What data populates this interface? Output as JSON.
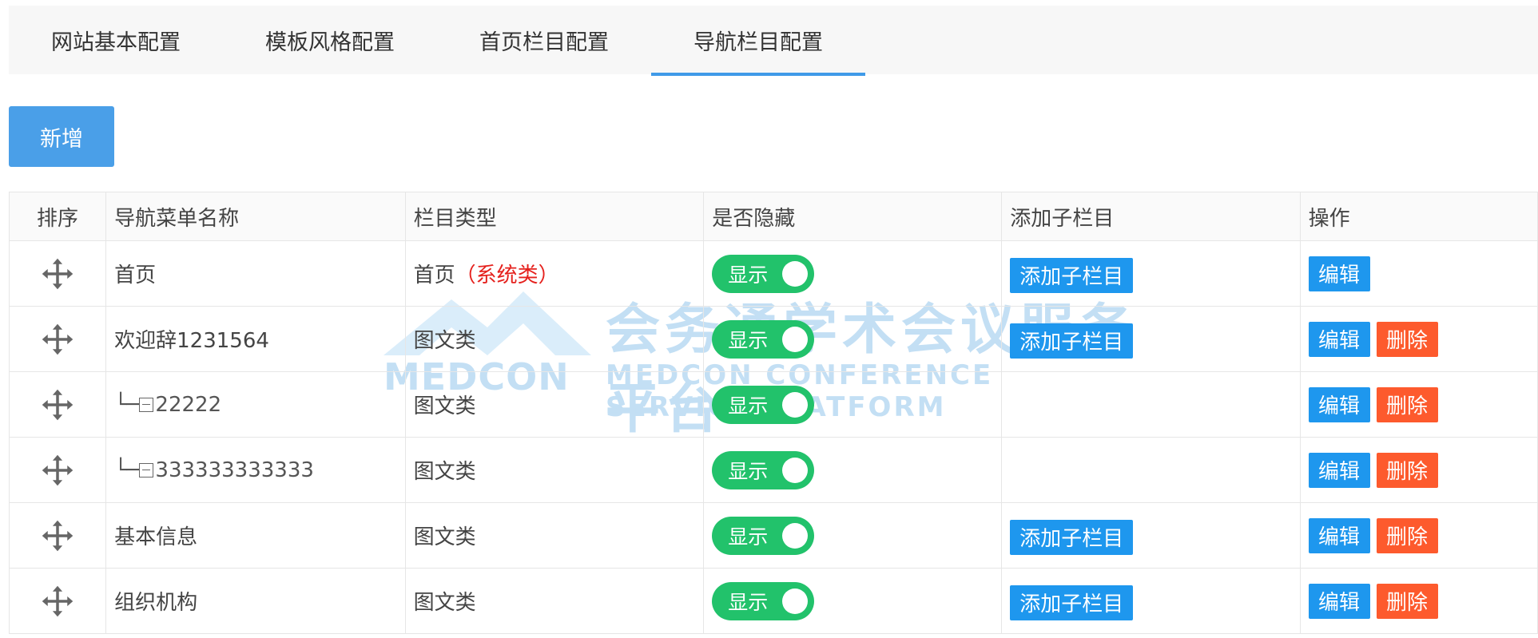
{
  "tabs": [
    "网站基本配置",
    "模板风格配置",
    "首页栏目配置",
    "导航栏目配置"
  ],
  "active_tab": "导航栏目配置",
  "add_button": "新增",
  "columns": [
    "排序",
    "导航菜单名称",
    "栏目类型",
    "是否隐藏",
    "添加子栏目",
    "操作"
  ],
  "rows": [
    {
      "name": "首页",
      "type": "首页",
      "type_note": "（系统类）",
      "toggle": "显示",
      "add_sub": "添加子栏目",
      "edit": "编辑",
      "delete": ""
    },
    {
      "name": "欢迎辞1231564",
      "type": "图文类",
      "type_note": "",
      "toggle": "显示",
      "add_sub": "添加子栏目",
      "edit": "编辑",
      "delete": "删除"
    },
    {
      "name": "22222",
      "type": "图文类",
      "type_note": "",
      "toggle": "显示",
      "add_sub": "",
      "edit": "编辑",
      "delete": "删除",
      "tree_prefix": "└─"
    },
    {
      "name": "333333333333",
      "type": "图文类",
      "type_note": "",
      "toggle": "显示",
      "add_sub": "",
      "edit": "编辑",
      "delete": "删除",
      "tree_prefix": "└─"
    },
    {
      "name": "基本信息",
      "type": "图文类",
      "type_note": "",
      "toggle": "显示",
      "add_sub": "添加子栏目",
      "edit": "编辑",
      "delete": "删除"
    },
    {
      "name": "组织机构",
      "type": "图文类",
      "type_note": "",
      "toggle": "显示",
      "add_sub": "添加子栏目",
      "edit": "编辑",
      "delete": "删除"
    }
  ],
  "watermark": {
    "title": "会务通学术会议服务平台",
    "subtitle": "MEDCON CONFERENCE SERVICE PLATFORM",
    "logo_text": "MEDCON"
  },
  "colors": {
    "accent": "#3f9ae8",
    "toggle_on": "#22c26b",
    "edit": "#1e97ee",
    "delete": "#fd5a2d",
    "system_note": "#e5211d"
  }
}
